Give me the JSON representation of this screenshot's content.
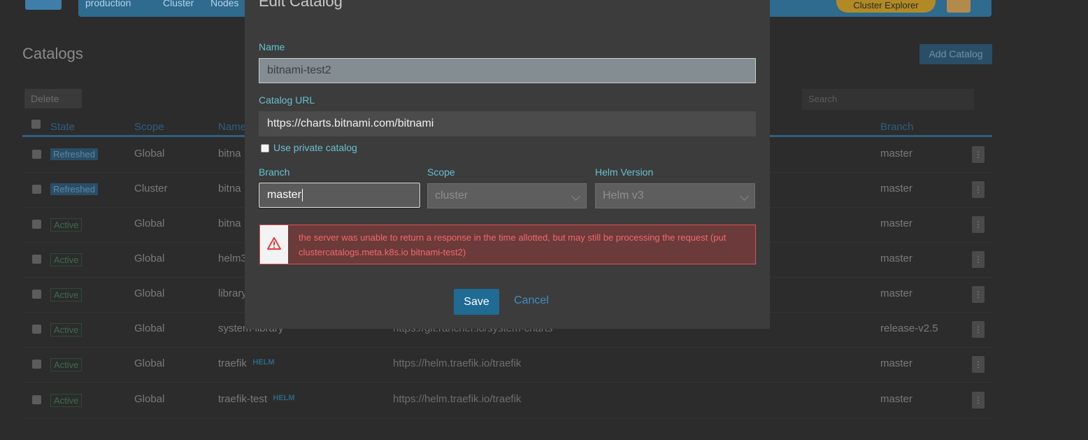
{
  "background": {
    "nav_items": [
      "production",
      "Cluster",
      "Nodes"
    ],
    "cluster_explorer": "Cluster Explorer",
    "page_title": "Catalogs",
    "add_catalog": "Add Catalog",
    "delete": "Delete",
    "search_placeholder": "Search",
    "columns": [
      "State",
      "Scope",
      "Name",
      "Branch"
    ],
    "rows": [
      {
        "state": "Refreshed",
        "scope": "Global",
        "name": "bitna",
        "url": "",
        "branch": "master",
        "helm": false
      },
      {
        "state": "Refreshed",
        "scope": "Cluster",
        "name": "bitna",
        "url": "",
        "branch": "master",
        "helm": false
      },
      {
        "state": "Active",
        "scope": "Global",
        "name": "bitna",
        "url": "",
        "branch": "master",
        "helm": false
      },
      {
        "state": "Active",
        "scope": "Global",
        "name": "helm3",
        "url": "",
        "branch": "master",
        "helm": false
      },
      {
        "state": "Active",
        "scope": "Global",
        "name": "library",
        "url": "",
        "branch": "master",
        "helm": false
      },
      {
        "state": "Active",
        "scope": "Global",
        "name": "system-library",
        "url": "https://git.rancher.io/system-charts",
        "branch": "release-v2.5",
        "helm": false
      },
      {
        "state": "Active",
        "scope": "Global",
        "name": "traefik",
        "url": "https://helm.traefik.io/traefik",
        "branch": "master",
        "helm": true
      },
      {
        "state": "Active",
        "scope": "Global",
        "name": "traefik-test",
        "url": "https://helm.traefik.io/traefik",
        "branch": "master",
        "helm": true
      }
    ],
    "helm_badge": "HELM"
  },
  "modal": {
    "title": "Edit Catalog",
    "name_label": "Name",
    "name_value": "bitnami-test2",
    "url_label": "Catalog URL",
    "url_value": "https://charts.bitnami.com/bitnami",
    "private_label": "Use private catalog",
    "branch_label": "Branch",
    "branch_value": "master",
    "scope_label": "Scope",
    "scope_value": "cluster",
    "helm_label": "Helm Version",
    "helm_value": "Helm v3",
    "error_message": "the server was unable to return a response in the time allotted, but may still be processing the request (put clustercatalogs.meta.k8s.io bitnami-test2)",
    "save": "Save",
    "cancel": "Cancel"
  },
  "colors": {
    "accent": "#1f6b93",
    "label": "#66c1d1",
    "error": "#f06a6a"
  }
}
